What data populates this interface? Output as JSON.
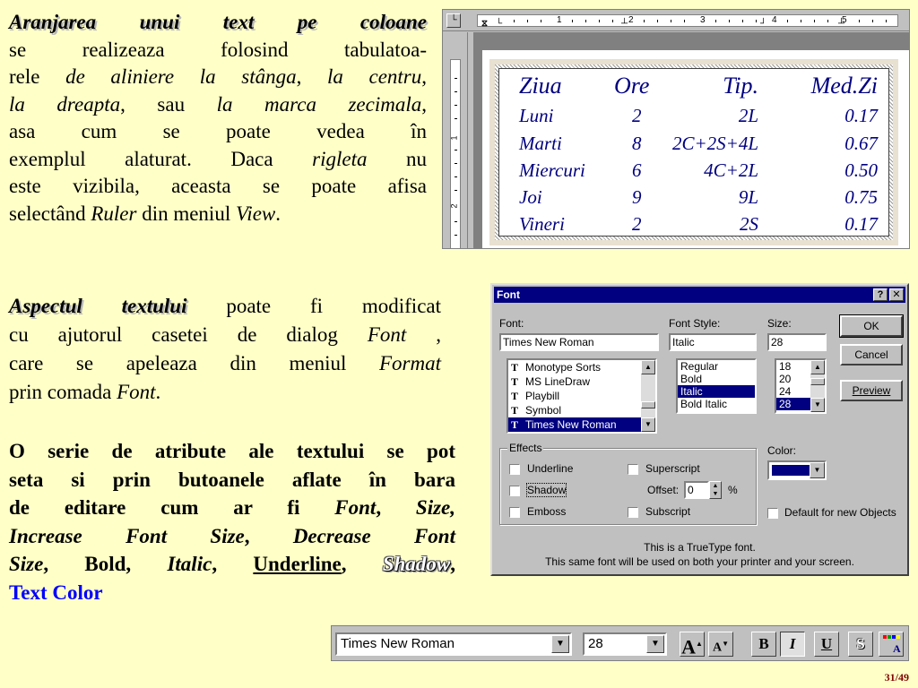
{
  "para1": {
    "title": "Aranjarea unui text pe coloane",
    "l2": "se realizeaza folosind tabulatoa-",
    "l3a": "rele ",
    "l3b": "de aliniere la stânga",
    "l3c": ", ",
    "l3d": "la centru",
    "l3e": ",",
    "l4a": "la dreapta",
    "l4b": ", sau ",
    "l4c": "la marca zecimala",
    "l4d": ",",
    "l5": "asa cum se poate vedea în",
    "l6a": "exemplul alaturat.  Daca ",
    "l6b": "rigleta",
    "l6c": " nu",
    "l7": "este vizibila, aceasta se poate afisa",
    "l8a": "selectând ",
    "l8b": "Ruler",
    "l8c": " din meniul ",
    "l8d": "View",
    "l8e": "."
  },
  "para2": {
    "title": "Aspectul textului",
    "l1b": " poate fi modificat",
    "l2a": "cu ajutorul casetei de dialog ",
    "l2b": "Font",
    "l2c": " ,",
    "l3a": "care se apeleaza din meniul ",
    "l3b": "Format",
    "l4a": "prin comada ",
    "l4b": "Font",
    "l4c": "."
  },
  "para3": {
    "l1": "O serie de atribute ale textului se pot",
    "l2": "seta si prin butoanele aflate în bara",
    "l3a": "de editare cum ar fi ",
    "l3b": "Font",
    "l3c": ", ",
    "l3d": "Size,",
    "l4a": "Increase Font Size",
    "l4b": ", ",
    "l4c": "Decrease Font",
    "l5a": "Size",
    "l5b": ", Bold, ",
    "l5c": "Italic",
    "l5d": ", ",
    "l5e": "Underline",
    "l5f": ", ",
    "l5g": "Shadow",
    "l5h": ",",
    "l6": "Text Color"
  },
  "word": {
    "ruler_numbers": [
      "1",
      "2",
      "3",
      "4",
      "5"
    ],
    "vruler_numbers": [
      "1",
      "2"
    ],
    "table": {
      "headers": [
        "Ziua",
        "Ore",
        "Tip.",
        "Med.Zi"
      ],
      "rows": [
        [
          "Luni",
          "2",
          "2L",
          "0.17"
        ],
        [
          "Marti",
          "8",
          "2C+2S+4L",
          "0.67"
        ],
        [
          "Miercuri",
          "6",
          "4C+2L",
          "0.50"
        ],
        [
          "Joi",
          "9",
          "9L",
          "0.75"
        ],
        [
          "Vineri",
          "2",
          "2S",
          "0.17"
        ]
      ]
    }
  },
  "dialog": {
    "title": "Font",
    "help_btn": "?",
    "close_btn": "✕",
    "font_label": "Font:",
    "font_value": "Times New Roman",
    "font_list": [
      "Monotype Sorts",
      "MS LineDraw",
      "Playbill",
      "Symbol",
      "Times New Roman"
    ],
    "style_label": "Font Style:",
    "style_value": "Italic",
    "style_list": [
      "Regular",
      "Bold",
      "Italic",
      "Bold Italic"
    ],
    "size_label": "Size:",
    "size_value": "28",
    "size_list": [
      "18",
      "20",
      "24",
      "28"
    ],
    "ok": "OK",
    "cancel": "Cancel",
    "preview": "Preview",
    "effects_label": "Effects",
    "underline": "Underline",
    "shadow": "Shadow",
    "emboss": "Emboss",
    "superscript": "Superscript",
    "offset_label": "Offset:",
    "offset_value": "0",
    "offset_unit": "%",
    "subscript": "Subscript",
    "color_label": "Color:",
    "color_value": "#000080",
    "default_label": "Default for new Objects",
    "info1": "This is a TrueType font.",
    "info2": "This same font will be used on both your printer and your screen."
  },
  "toolbar": {
    "font": "Times New Roman",
    "size": "28",
    "bold": "B",
    "italic": "I",
    "underline": "U",
    "shadow": "S"
  },
  "page_number": "31/49"
}
